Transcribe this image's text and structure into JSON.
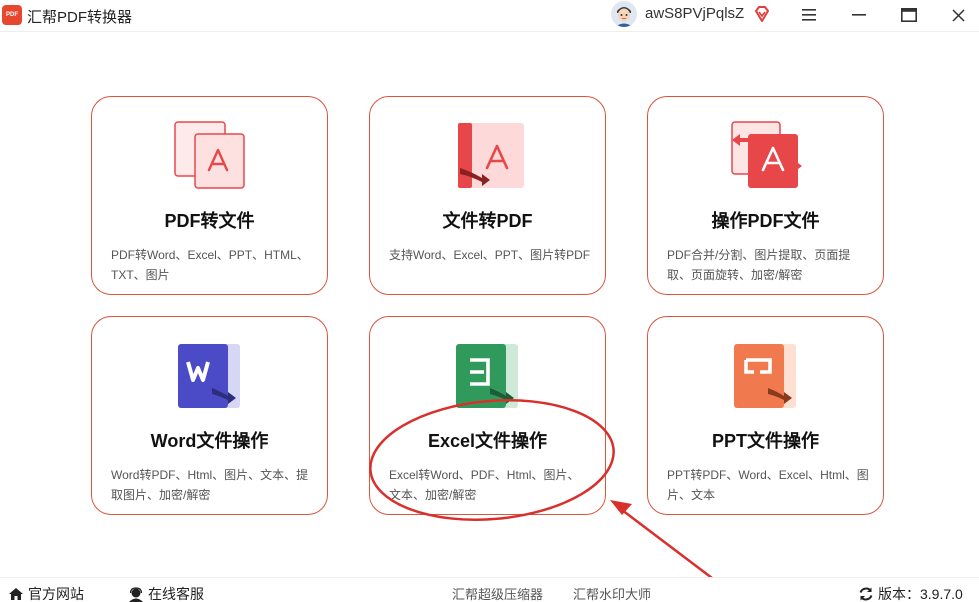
{
  "window": {
    "app_logo_text": "PDF",
    "title": "汇帮PDF转换器",
    "username": "awS8PVjPqlsZ"
  },
  "cards": [
    {
      "title": "PDF转文件",
      "desc": "PDF转Word、Excel、PPT、HTML、TXT、图片",
      "icon": "pdf-to-file-icon"
    },
    {
      "title": "文件转PDF",
      "desc": "支持Word、Excel、PPT、图片转PDF",
      "icon": "file-to-pdf-icon"
    },
    {
      "title": "操作PDF文件",
      "desc": "PDF合并/分割、图片提取、页面提取、页面旋转、加密/解密",
      "icon": "pdf-operations-icon"
    },
    {
      "title": "Word文件操作",
      "desc": "Word转PDF、Html、图片、文本、提取图片、加密/解密",
      "icon": "word-icon"
    },
    {
      "title": "Excel文件操作",
      "desc": "Excel转Word、PDF、Html、图片、文本、加密/解密",
      "icon": "excel-icon"
    },
    {
      "title": "PPT文件操作",
      "desc": "PPT转PDF、Word、Excel、Html、图片、文本",
      "icon": "ppt-icon"
    }
  ],
  "footer": {
    "official_site": "官方网站",
    "online_service": "在线客服",
    "compressor": "汇帮超级压缩器",
    "watermark": "汇帮水印大师",
    "version_label": "版本：",
    "version": "3.9.7.0"
  },
  "colors": {
    "accent": "#d9553c",
    "pdf_red": "#e8474a",
    "word_blue": "#4b4bc7",
    "excel_green": "#2f9a5c",
    "ppt_orange": "#f07a4d",
    "annotation_red": "#d9302c"
  }
}
